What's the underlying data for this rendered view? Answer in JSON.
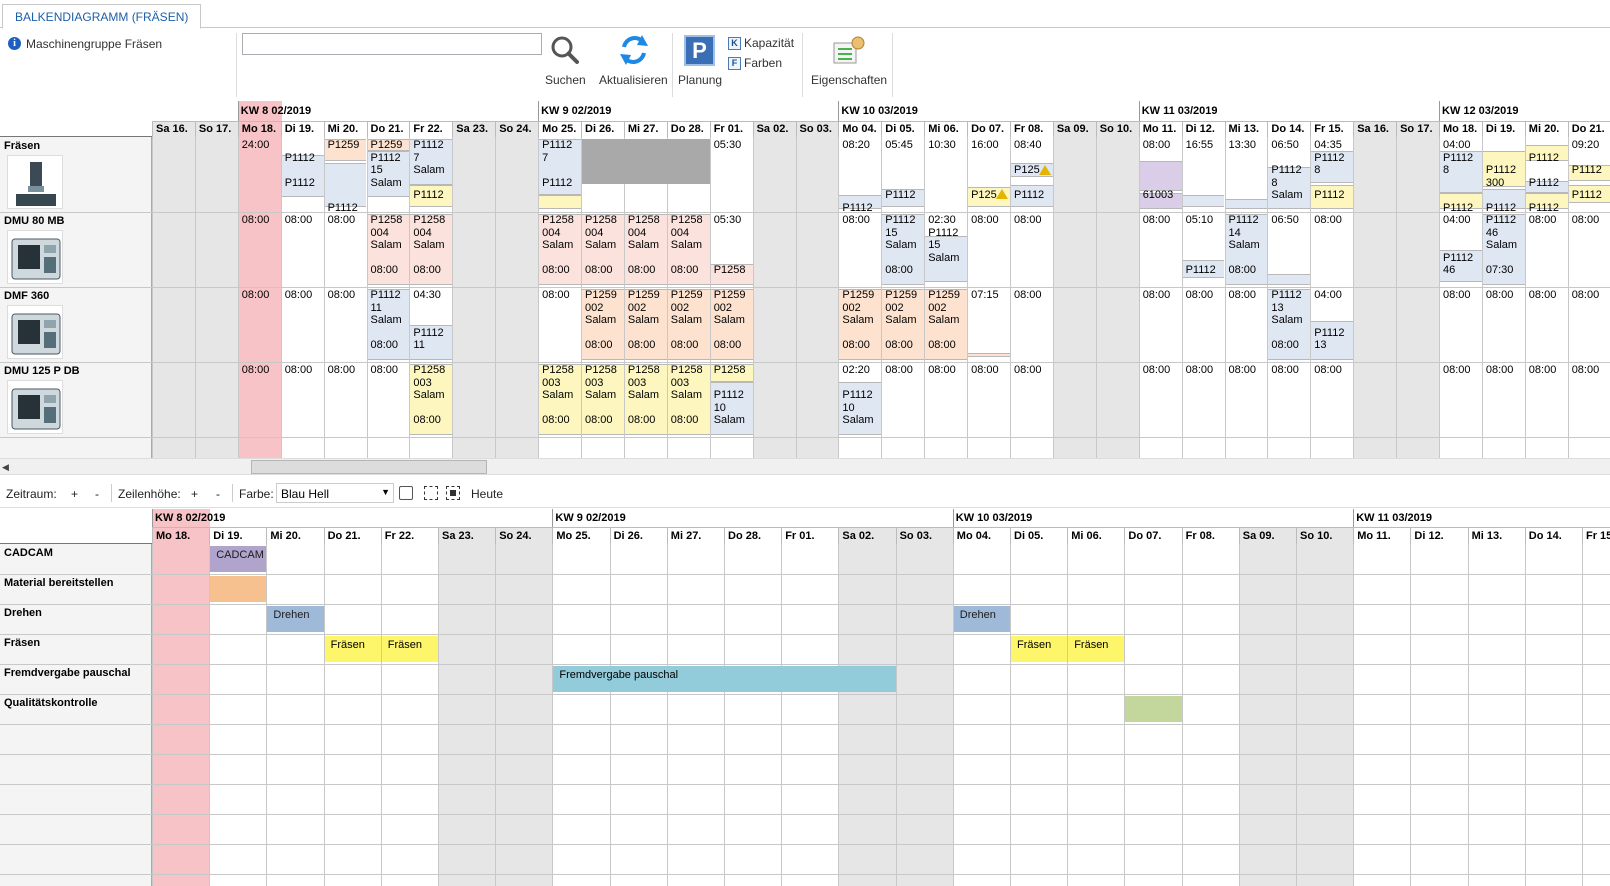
{
  "tab": {
    "title": "BALKENDIAGRAMM (FRÄSEN)"
  },
  "ribbon": {
    "info_text": "Maschinengruppe Fräsen",
    "search_value": "",
    "search_label": "Suchen",
    "refresh_label": "Aktualisieren",
    "planning_label": "Planung",
    "capacity_label": "Kapazität",
    "colors_label": "Farben",
    "properties_label": "Eigenschaften"
  },
  "top_chart": {
    "weeks": [
      "KW 8 02/2019",
      "KW 9 02/2019",
      "KW 10 03/2019",
      "KW 11 03/2019",
      "KW 12 03/2019"
    ],
    "days": [
      "Sa 16.",
      "So 17.",
      "Mo 18.",
      "Di 19.",
      "Mi 20.",
      "Do 21.",
      "Fr 22.",
      "Sa 23.",
      "So 24.",
      "Mo 25.",
      "Di 26.",
      "Mi 27.",
      "Do 28.",
      "Fr 01.",
      "Sa 02.",
      "So 03.",
      "Mo 04.",
      "Di 05.",
      "Mi 06.",
      "Do 07.",
      "Fr 08.",
      "Sa 09.",
      "So 10.",
      "Mo 11.",
      "Di 12.",
      "Mi 13.",
      "Do 14.",
      "Fr 15.",
      "Sa 16.",
      "So 17.",
      "Mo 18.",
      "Di 19.",
      "Mi 20.",
      "Do 21."
    ],
    "machines": [
      "Fräsen",
      "DMU 80 MB",
      "DMF 360",
      "DMU 125 P DB"
    ],
    "cells": [
      {
        "row": 0,
        "day": 2,
        "text": "24:00"
      },
      {
        "row": 0,
        "day": 3,
        "text": "\nP1112\n\nP1112"
      },
      {
        "row": 0,
        "day": 4,
        "text": "P1259\n\n\n\n\nP1112"
      },
      {
        "row": 0,
        "day": 5,
        "text": "P1259\nP1112\n15\nSalam"
      },
      {
        "row": 0,
        "day": 6,
        "text": "P1112\n7\nSalam\n\nP1112"
      },
      {
        "row": 0,
        "day": 9,
        "text": "P1112\n7\n\nP1112"
      },
      {
        "row": 0,
        "day": 13,
        "text": "05:30"
      },
      {
        "row": 0,
        "day": 16,
        "text": "08:20\n\n\n\n\nP1112"
      },
      {
        "row": 0,
        "day": 17,
        "text": "05:45\n\n\n\nP1112"
      },
      {
        "row": 0,
        "day": 18,
        "text": "10:30"
      },
      {
        "row": 0,
        "day": 19,
        "text": "16:00\n\n\n\nP125"
      },
      {
        "row": 0,
        "day": 20,
        "text": "08:40\n\nP125\n\nP1112"
      },
      {
        "row": 0,
        "day": 23,
        "text": "08:00\n\n\n\n61003"
      },
      {
        "row": 0,
        "day": 24,
        "text": "16:55"
      },
      {
        "row": 0,
        "day": 25,
        "text": "13:30"
      },
      {
        "row": 0,
        "day": 26,
        "text": "06:50\n\nP1112\n8\nSalam"
      },
      {
        "row": 0,
        "day": 27,
        "text": "04:35\nP1112\n8\n\nP1112"
      },
      {
        "row": 0,
        "day": 30,
        "text": "04:00\nP1112\n8\n\n\nP1112"
      },
      {
        "row": 0,
        "day": 31,
        "text": "\n\nP1112\n300\n\nP1112"
      },
      {
        "row": 0,
        "day": 32,
        "text": "\nP1112\n\nP1112\n\nP1112"
      },
      {
        "row": 0,
        "day": 33,
        "text": "09:20\n\nP1112\n\nP1112"
      },
      {
        "row": 1,
        "day": 2,
        "text": "08:00"
      },
      {
        "row": 1,
        "day": 3,
        "text": "08:00"
      },
      {
        "row": 1,
        "day": 4,
        "text": "08:00"
      },
      {
        "row": 1,
        "day": 5,
        "text": "P1258\n004\nSalam\n\n08:00"
      },
      {
        "row": 1,
        "day": 6,
        "text": "P1258\n004\nSalam\n\n08:00"
      },
      {
        "row": 1,
        "day": 9,
        "text": "P1258\n004\nSalam\n\n08:00"
      },
      {
        "row": 1,
        "day": 10,
        "text": "P1258\n004\nSalam\n\n08:00"
      },
      {
        "row": 1,
        "day": 11,
        "text": "P1258\n004\nSalam\n\n08:00"
      },
      {
        "row": 1,
        "day": 12,
        "text": "P1258\n004\nSalam\n\n08:00"
      },
      {
        "row": 1,
        "day": 13,
        "text": "05:30\n\n\n\nP1258"
      },
      {
        "row": 1,
        "day": 16,
        "text": "08:00"
      },
      {
        "row": 1,
        "day": 17,
        "text": "P1112\n15\nSalam\n\n08:00"
      },
      {
        "row": 1,
        "day": 18,
        "text": "02:30\nP1112\n15\nSalam"
      },
      {
        "row": 1,
        "day": 19,
        "text": "08:00"
      },
      {
        "row": 1,
        "day": 20,
        "text": "08:00"
      },
      {
        "row": 1,
        "day": 23,
        "text": "08:00"
      },
      {
        "row": 1,
        "day": 24,
        "text": "05:10\n\n\n\nP1112"
      },
      {
        "row": 1,
        "day": 25,
        "text": "P1112\n14\nSalam\n\n08:00"
      },
      {
        "row": 1,
        "day": 26,
        "text": "06:50"
      },
      {
        "row": 1,
        "day": 27,
        "text": "08:00"
      },
      {
        "row": 1,
        "day": 30,
        "text": "04:00\n\n\nP1112\n46"
      },
      {
        "row": 1,
        "day": 31,
        "text": "P1112\n46\nSalam\n\n07:30"
      },
      {
        "row": 1,
        "day": 32,
        "text": "08:00"
      },
      {
        "row": 1,
        "day": 33,
        "text": "08:00"
      },
      {
        "row": 2,
        "day": 2,
        "text": "08:00"
      },
      {
        "row": 2,
        "day": 3,
        "text": "08:00"
      },
      {
        "row": 2,
        "day": 4,
        "text": "08:00"
      },
      {
        "row": 2,
        "day": 5,
        "text": "P1112\n11\nSalam\n\n08:00"
      },
      {
        "row": 2,
        "day": 6,
        "text": "04:30\n\n\nP1112\n11"
      },
      {
        "row": 2,
        "day": 9,
        "text": "08:00"
      },
      {
        "row": 2,
        "day": 10,
        "text": "P1259\n002\nSalam\n\n08:00"
      },
      {
        "row": 2,
        "day": 11,
        "text": "P1259\n002\nSalam\n\n08:00"
      },
      {
        "row": 2,
        "day": 12,
        "text": "P1259\n002\nSalam\n\n08:00"
      },
      {
        "row": 2,
        "day": 13,
        "text": "P1259\n002\nSalam\n\n08:00"
      },
      {
        "row": 2,
        "day": 16,
        "text": "P1259\n002\nSalam\n\n08:00"
      },
      {
        "row": 2,
        "day": 17,
        "text": "P1259\n002\nSalam\n\n08:00"
      },
      {
        "row": 2,
        "day": 18,
        "text": "P1259\n002\nSalam\n\n08:00"
      },
      {
        "row": 2,
        "day": 19,
        "text": "07:15"
      },
      {
        "row": 2,
        "day": 20,
        "text": "08:00"
      },
      {
        "row": 2,
        "day": 23,
        "text": "08:00"
      },
      {
        "row": 2,
        "day": 24,
        "text": "08:00"
      },
      {
        "row": 2,
        "day": 25,
        "text": "08:00"
      },
      {
        "row": 2,
        "day": 26,
        "text": "P1112\n13\nSalam\n\n08:00"
      },
      {
        "row": 2,
        "day": 27,
        "text": "04:00\n\n\nP1112\n13"
      },
      {
        "row": 2,
        "day": 30,
        "text": "08:00"
      },
      {
        "row": 2,
        "day": 31,
        "text": "08:00"
      },
      {
        "row": 2,
        "day": 32,
        "text": "08:00"
      },
      {
        "row": 2,
        "day": 33,
        "text": "08:00"
      },
      {
        "row": 3,
        "day": 2,
        "text": "08:00"
      },
      {
        "row": 3,
        "day": 3,
        "text": "08:00"
      },
      {
        "row": 3,
        "day": 4,
        "text": "08:00"
      },
      {
        "row": 3,
        "day": 5,
        "text": "08:00"
      },
      {
        "row": 3,
        "day": 6,
        "text": "P1258\n003\nSalam\n\n08:00"
      },
      {
        "row": 3,
        "day": 9,
        "text": "P1258\n003\nSalam\n\n08:00"
      },
      {
        "row": 3,
        "day": 10,
        "text": "P1258\n003\nSalam\n\n08:00"
      },
      {
        "row": 3,
        "day": 11,
        "text": "P1258\n003\nSalam\n\n08:00"
      },
      {
        "row": 3,
        "day": 12,
        "text": "P1258\n003\nSalam\n\n08:00"
      },
      {
        "row": 3,
        "day": 13,
        "text": "P1258\n\nP1112\n10\nSalam"
      },
      {
        "row": 3,
        "day": 16,
        "text": "02:20\n\nP1112\n10\nSalam"
      },
      {
        "row": 3,
        "day": 17,
        "text": "08:00"
      },
      {
        "row": 3,
        "day": 18,
        "text": "08:00"
      },
      {
        "row": 3,
        "day": 19,
        "text": "08:00"
      },
      {
        "row": 3,
        "day": 20,
        "text": "08:00"
      },
      {
        "row": 3,
        "day": 23,
        "text": "08:00"
      },
      {
        "row": 3,
        "day": 24,
        "text": "08:00"
      },
      {
        "row": 3,
        "day": 25,
        "text": "08:00"
      },
      {
        "row": 3,
        "day": 26,
        "text": "08:00"
      },
      {
        "row": 3,
        "day": 27,
        "text": "08:00"
      },
      {
        "row": 3,
        "day": 30,
        "text": "08:00"
      },
      {
        "row": 3,
        "day": 31,
        "text": "08:00"
      },
      {
        "row": 3,
        "day": 32,
        "text": "08:00"
      },
      {
        "row": 3,
        "day": 33,
        "text": "08:00"
      }
    ]
  },
  "toolbar": {
    "period_label": "Zeitraum:",
    "row_height_label": "Zeilenhöhe:",
    "plus": "+",
    "minus": "-",
    "color_label": "Farbe:",
    "color_value": "Blau Hell",
    "today_label": "Heute"
  },
  "bottom_chart": {
    "weeks": [
      "KW 8 02/2019",
      "KW 9 02/2019",
      "KW 10 03/2019",
      "KW 11 03/2019"
    ],
    "days": [
      "Mo 18.",
      "Di 19.",
      "Mi 20.",
      "Do 21.",
      "Fr 22.",
      "Sa 23.",
      "So 24.",
      "Mo 25.",
      "Di 26.",
      "Mi 27.",
      "Do 28.",
      "Fr 01.",
      "Sa 02.",
      "So 03.",
      "Mo 04.",
      "Di 05.",
      "Mi 06.",
      "Do 07.",
      "Fr 08.",
      "Sa 09.",
      "So 10.",
      "Mo 11.",
      "Di 12.",
      "Mi 13.",
      "Do 14.",
      "Fr 15."
    ],
    "rows": [
      "CADCAM",
      "Material bereitstellen",
      "Drehen",
      "Fräsen",
      "Fremdvergabe pauschal",
      "Qualitätskontrolle"
    ],
    "bars": [
      {
        "row": 0,
        "start": 1,
        "span": 1,
        "text": "CADCAM",
        "color": "#b0a3cc"
      },
      {
        "row": 1,
        "start": 1,
        "span": 1,
        "text": "",
        "color": "#f7c08f"
      },
      {
        "row": 2,
        "start": 2,
        "span": 1,
        "text": "Drehen",
        "color": "#9fb9d9"
      },
      {
        "row": 3,
        "start": 3,
        "span": 1,
        "text": "Fräsen",
        "color": "#fdf56a"
      },
      {
        "row": 3,
        "start": 4,
        "span": 1,
        "text": "Fräsen",
        "color": "#fdf56a"
      },
      {
        "row": 4,
        "start": 7,
        "span": 6,
        "text": "Fremdvergabe pauschal",
        "color": "#92cbd9"
      },
      {
        "row": 2,
        "start": 14,
        "span": 1,
        "text": "Drehen",
        "color": "#9fb9d9"
      },
      {
        "row": 3,
        "start": 15,
        "span": 1,
        "text": "Fräsen",
        "color": "#fdf56a"
      },
      {
        "row": 3,
        "start": 16,
        "span": 1,
        "text": "Fräsen",
        "color": "#fdf56a"
      },
      {
        "row": 5,
        "start": 17,
        "span": 1,
        "text": "",
        "color": "#c3d69b"
      }
    ]
  }
}
